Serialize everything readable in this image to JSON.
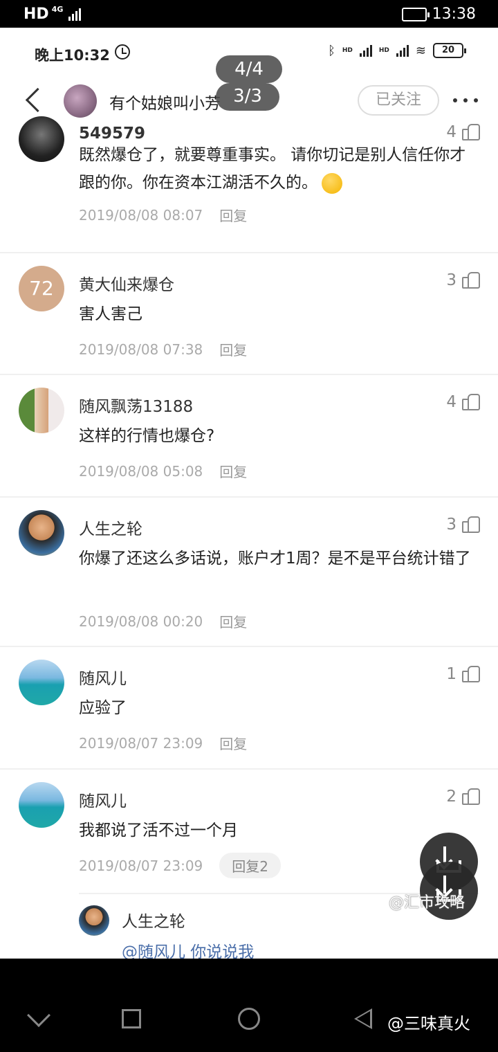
{
  "outer_status": {
    "network": "HD",
    "net_type": "4G",
    "time": "13:38"
  },
  "inner_status": {
    "time": "晚上10:32",
    "battery": "20",
    "network_label": "HD"
  },
  "pager": {
    "primary": "4/4",
    "secondary": "3/3"
  },
  "header": {
    "author_name": "有个姑娘叫小芳",
    "follow_label": "已关注"
  },
  "comments": [
    {
      "name": "549579",
      "likes": "4",
      "text": "既然爆仓了，就要尊重事实。 请你切记是别人信任你才跟的你。你在资本江湖活不久的。",
      "time": "2019/08/08 08:07",
      "reply": "回复",
      "avatar_icon": "dark-illustration-avatar"
    },
    {
      "name": "黄大仙来爆仓",
      "likes": "3",
      "text": "害人害己",
      "time": "2019/08/08 07:38",
      "reply": "回复",
      "avatar_text": "72"
    },
    {
      "name": "随风飘荡13188",
      "likes": "4",
      "text": "这样的行情也爆仓?",
      "time": "2019/08/08 05:08",
      "reply": "回复",
      "avatar_icon": "bottle-photo-avatar"
    },
    {
      "name": "人生之轮",
      "likes": "3",
      "text": "你爆了还这么多话说，账户才1周？是不是平台统计错了",
      "time": "2019/08/08 00:20",
      "reply": "回复",
      "avatar_icon": "person-photo-avatar"
    },
    {
      "name": "随风儿",
      "likes": "1",
      "text": "应验了",
      "time": "2019/08/07 23:09",
      "reply": "回复",
      "avatar_icon": "sea-photo-avatar"
    },
    {
      "name": "随风儿",
      "likes": "2",
      "text": "我都说了活不过一个月",
      "time": "2019/08/07 23:09",
      "reply": "回复2",
      "avatar_icon": "sea-photo-avatar"
    }
  ],
  "sub_reply": {
    "name": "人生之轮",
    "text": "@随风儿 你说说我"
  },
  "watermarks": {
    "first": "@汇市攻略",
    "second": "@三味真火"
  },
  "colors": {
    "accent_link": "#4a6ea9",
    "avatar_72_bg": "#d4ab8c"
  }
}
